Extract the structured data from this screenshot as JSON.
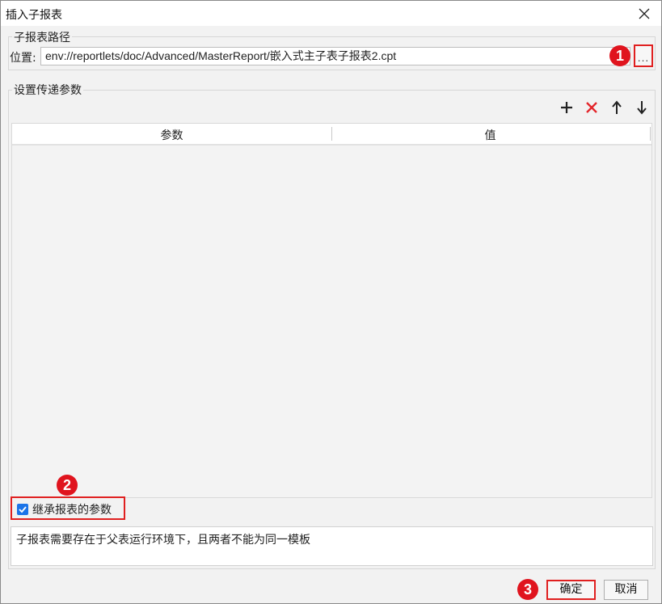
{
  "window": {
    "title": "插入子报表",
    "close_icon": "close-icon"
  },
  "path_group": {
    "legend": "子报表路径",
    "location_label": "位置:",
    "location_value": "env://reportlets/doc/Advanced/MasterReport/嵌入式主子表子报表2.cpt",
    "browse_label": "..."
  },
  "params_group": {
    "legend": "设置传递参数",
    "toolbar": {
      "add_icon": "plus-icon",
      "delete_icon": "delete-x-icon",
      "up_icon": "arrow-up-icon",
      "down_icon": "arrow-down-icon"
    },
    "columns": [
      "参数",
      "值"
    ],
    "rows": []
  },
  "inherit": {
    "label": "继承报表的参数",
    "checked": true
  },
  "note": "子报表需要存在于父表运行环境下，且两者不能为同一模板",
  "buttons": {
    "ok": "确定",
    "cancel": "取消"
  },
  "annotations": {
    "badge1": "1",
    "badge2": "2",
    "badge3": "3"
  },
  "colors": {
    "accent_red": "#e02020",
    "badge_red": "#e0141e",
    "checkbox_blue": "#1c74e8"
  }
}
